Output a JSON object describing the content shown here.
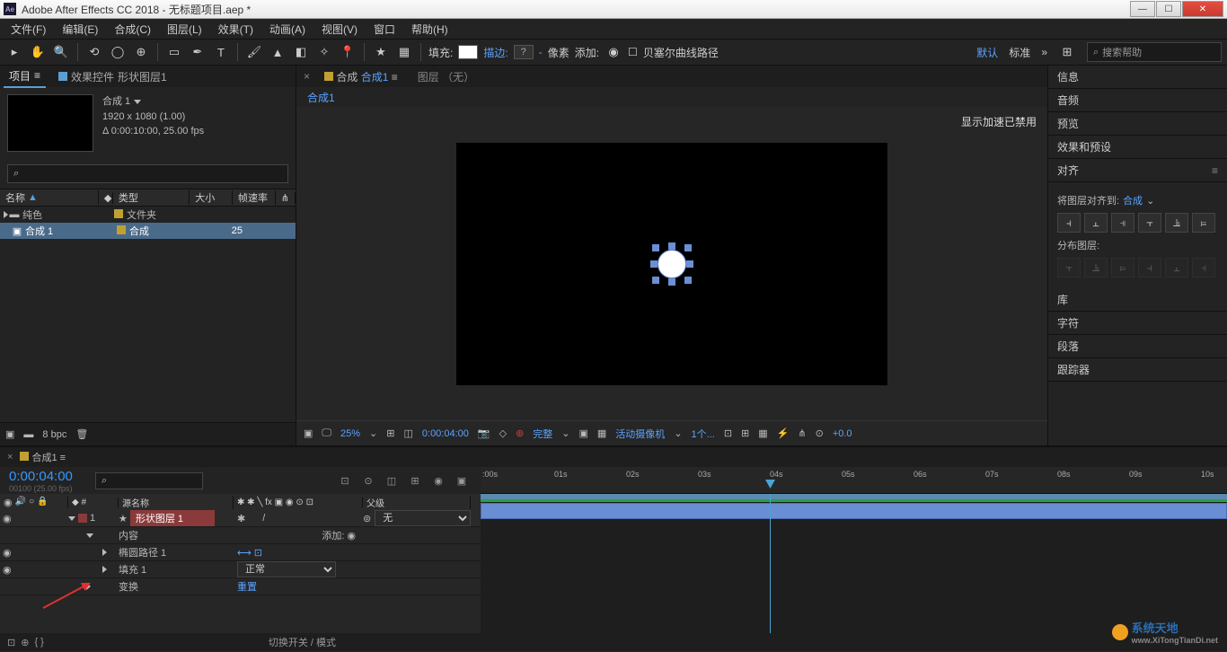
{
  "titlebar": {
    "app": "Adobe After Effects CC 2018 - 无标题项目.aep *"
  },
  "menu": {
    "file": "文件(F)",
    "edit": "编辑(E)",
    "comp": "合成(C)",
    "layer": "图层(L)",
    "effect": "效果(T)",
    "anim": "动画(A)",
    "view": "视图(V)",
    "window": "窗口",
    "help": "帮助(H)"
  },
  "toolbar": {
    "fill": "填充:",
    "stroke": "描边:",
    "px": "像素",
    "add": "添加:",
    "bezier": "贝塞尔曲线路径",
    "workspace_default": "默认",
    "workspace_standard": "标准",
    "search_ph": "搜索帮助"
  },
  "project": {
    "tab": "项目",
    "tab2_prefix": "效果控件 ",
    "tab2_name": "形状图层1",
    "comp_name": "合成 1",
    "dim": "1920 x 1080 (1.00)",
    "dur": "Δ 0:00:10:00, 25.00 fps",
    "col_name": "名称",
    "col_type": "类型",
    "col_size": "大小",
    "col_fps": "帧速率",
    "rows": [
      {
        "name": "纯色",
        "type": "文件夹",
        "fps": ""
      },
      {
        "name": "合成 1",
        "type": "合成",
        "fps": "25"
      }
    ],
    "bpc": "8 bpc"
  },
  "comp": {
    "tab_prefix": "合成 ",
    "tab_name": "合成1",
    "layer_tab": "图层 （无）",
    "crumb": "合成1",
    "accel": "显示加速已禁用",
    "zoom": "25%",
    "time": "0:00:04:00",
    "res": "完整",
    "camera": "活动摄像机",
    "view": "1个...",
    "exposure": "+0.0"
  },
  "right": {
    "info": "信息",
    "audio": "音频",
    "preview": "预览",
    "effects": "效果和预设",
    "align": "对齐",
    "align_to_label": "将图层对齐到:",
    "align_to_value": "合成",
    "distribute": "分布图层:",
    "library": "库",
    "char": "字符",
    "para": "段落",
    "tracker": "跟踪器"
  },
  "timeline": {
    "tab": "合成1",
    "time": "0:00:04:00",
    "frame_info": "00100 (25.00 fps)",
    "col_src": "源名称",
    "col_parent": "父级",
    "layer_num": "1",
    "layer_name": "形状图层 1",
    "parent_none": "无",
    "contents": "内容",
    "add": "添加:",
    "ellipse": "椭圆路径 1",
    "fill": "填充 1",
    "fill_mode": "正常",
    "transform": "变换",
    "reset": "重置",
    "footer": "切换开关 / 模式",
    "ticks": [
      ":00s",
      "01s",
      "02s",
      "03s",
      "04s",
      "05s",
      "06s",
      "07s",
      "08s",
      "09s",
      "10s"
    ]
  },
  "watermark": {
    "line1": "系统天地",
    "line2": "www.XiTongTianDi.net"
  }
}
